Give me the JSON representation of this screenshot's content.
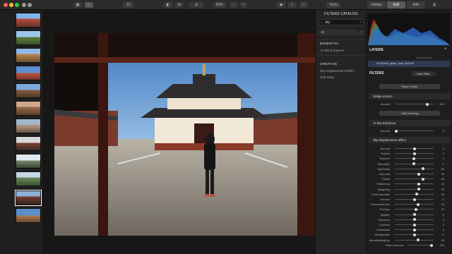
{
  "toolbar": {
    "zoom": "60%",
    "count": "15",
    "tools_label": "Tools",
    "tabs": [
      "Library",
      "Edit",
      "Info"
    ],
    "active_tab": "Edit"
  },
  "catalog": {
    "title": "FILTERS CATALOG",
    "search_value": "sky",
    "filter_option": "All",
    "groups": [
      {
        "heading": "ESSENTIAL",
        "items": [
          "AI Sky Enhancer"
        ]
      },
      {
        "heading": "CREATIVE",
        "items": [
          "Sky Replacement Effect",
          "Soft Glow"
        ]
      }
    ]
  },
  "right_panel": {
    "layers_title": "LAYERS",
    "layers_option": "Opacity Layer",
    "layer_filename": "20150418_japan_nara_0433.tif",
    "filters_title": "FILTERS",
    "add_filter_label": "+ Add Filter...",
    "place_center_label": "Place Center",
    "dodge_burn": {
      "title": "Dodge & Burn",
      "amount_label": "Amount",
      "amount_value": "100",
      "start_painting": "Start Painting"
    },
    "ai_sky": {
      "title": "AI Sky Enhancer",
      "amount_label": "Amount",
      "amount_value": "0"
    },
    "sky_replacement": {
      "title": "Sky Replacement Effect",
      "params": [
        {
          "label": "Amount",
          "value": "0"
        },
        {
          "label": "Texture",
          "value": "0"
        },
        {
          "label": "Texture1",
          "value": "-1"
        },
        {
          "label": "Texture2D",
          "value": "-1"
        },
        {
          "label": "SkyGlobal",
          "value": "50"
        },
        {
          "label": "SkyLocal",
          "value": "25"
        },
        {
          "label": "Plants",
          "value": "50"
        },
        {
          "label": "Feathering",
          "value": "25"
        },
        {
          "label": "Relighting",
          "value": "25"
        },
        {
          "label": "ToneCorrection",
          "value": "15"
        },
        {
          "label": "Horizon",
          "value": "0"
        },
        {
          "label": "HorizonSmooth",
          "value": "20"
        },
        {
          "label": "FixGaps",
          "value": "10"
        },
        {
          "label": "SkyBlur",
          "value": "0"
        },
        {
          "label": "Exposure",
          "value": "0"
        },
        {
          "label": "Contrast",
          "value": "0"
        },
        {
          "label": "Showmask",
          "value": "0"
        },
        {
          "label": "Showinpaint",
          "value": "0"
        },
        {
          "label": "AlphaMattingExp",
          "value": "20"
        }
      ]
    },
    "filters_amount_label": "Filters Amount",
    "filters_amount_value": "100"
  },
  "colors": {
    "accent": "#2e6fd8",
    "panel_bg": "#1e1e1e",
    "toolbar_bg": "#2b2b2b"
  }
}
